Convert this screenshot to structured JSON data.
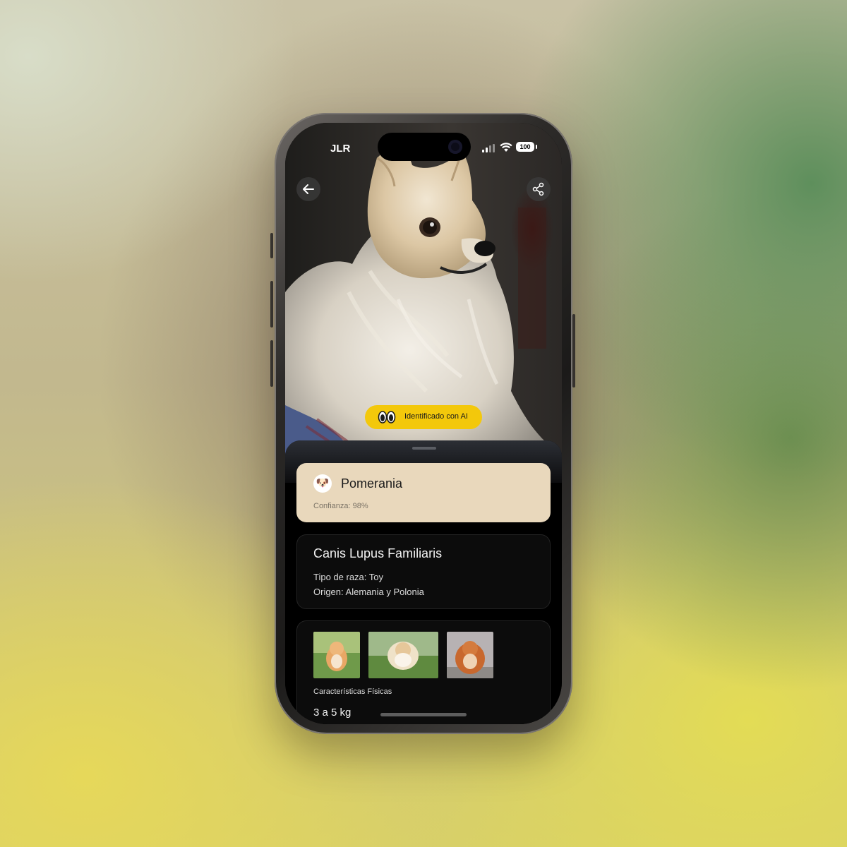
{
  "status_bar": {
    "carrier": "JLR",
    "battery": "100",
    "signal_icon": "signal-bars-icon",
    "wifi_icon": "wifi-icon"
  },
  "header": {
    "back_icon": "arrow-left-icon",
    "share_icon": "share-icon"
  },
  "hero": {
    "subject": "pomeranian-dog-photo",
    "badge_label": "Identificado con AI",
    "badge_icon": "eyes-icon",
    "badge_color": "#f3c80b"
  },
  "result": {
    "emoji": "🐶",
    "breed": "Pomerania",
    "confidence": "Confianza: 98%",
    "card_color": "#e9d8bc"
  },
  "details": {
    "scientific_name": "Canis Lupus Familiaris",
    "breed_type": "Tipo de raza: Toy",
    "origin": "Origen: Alemania y Polonia"
  },
  "gallery": {
    "images": [
      "pomeranian-grass-photo",
      "pomeranian-lawn-photo",
      "pomeranian-orange-photo"
    ],
    "section_label": "Características Físicas",
    "weight": "3 a 5 kg"
  }
}
